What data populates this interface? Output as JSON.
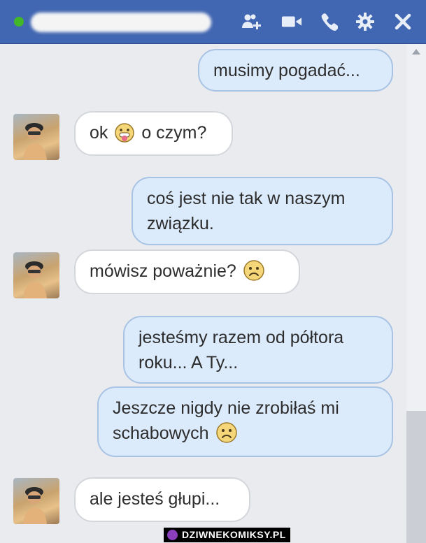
{
  "header": {
    "background": "#4267b2",
    "online_color": "#42b72a",
    "icons": [
      "add-people-icon",
      "video-camera-icon",
      "phone-icon",
      "gear-icon",
      "close-icon"
    ]
  },
  "messages": [
    {
      "from": "me",
      "text": "musimy pogadać..."
    },
    {
      "from": "them",
      "text_before": "ok",
      "emoji": "tongue-emoji",
      "text_after": "o czym?"
    },
    {
      "from": "me",
      "text": "coś jest nie tak w naszym związku."
    },
    {
      "from": "them",
      "text_before": "mówisz poważnie?",
      "emoji": "sad-emoji"
    },
    {
      "from": "me",
      "text": "jesteśmy razem od półtora roku... A Ty..."
    },
    {
      "from": "me",
      "text_before": "Jeszcze nigdy nie zrobiłaś mi schabowych",
      "emoji": "sad-emoji"
    },
    {
      "from": "them",
      "text": "ale jesteś głupi..."
    }
  ],
  "watermark": {
    "text": "DZIWNEKOMIKSY.PL"
  }
}
